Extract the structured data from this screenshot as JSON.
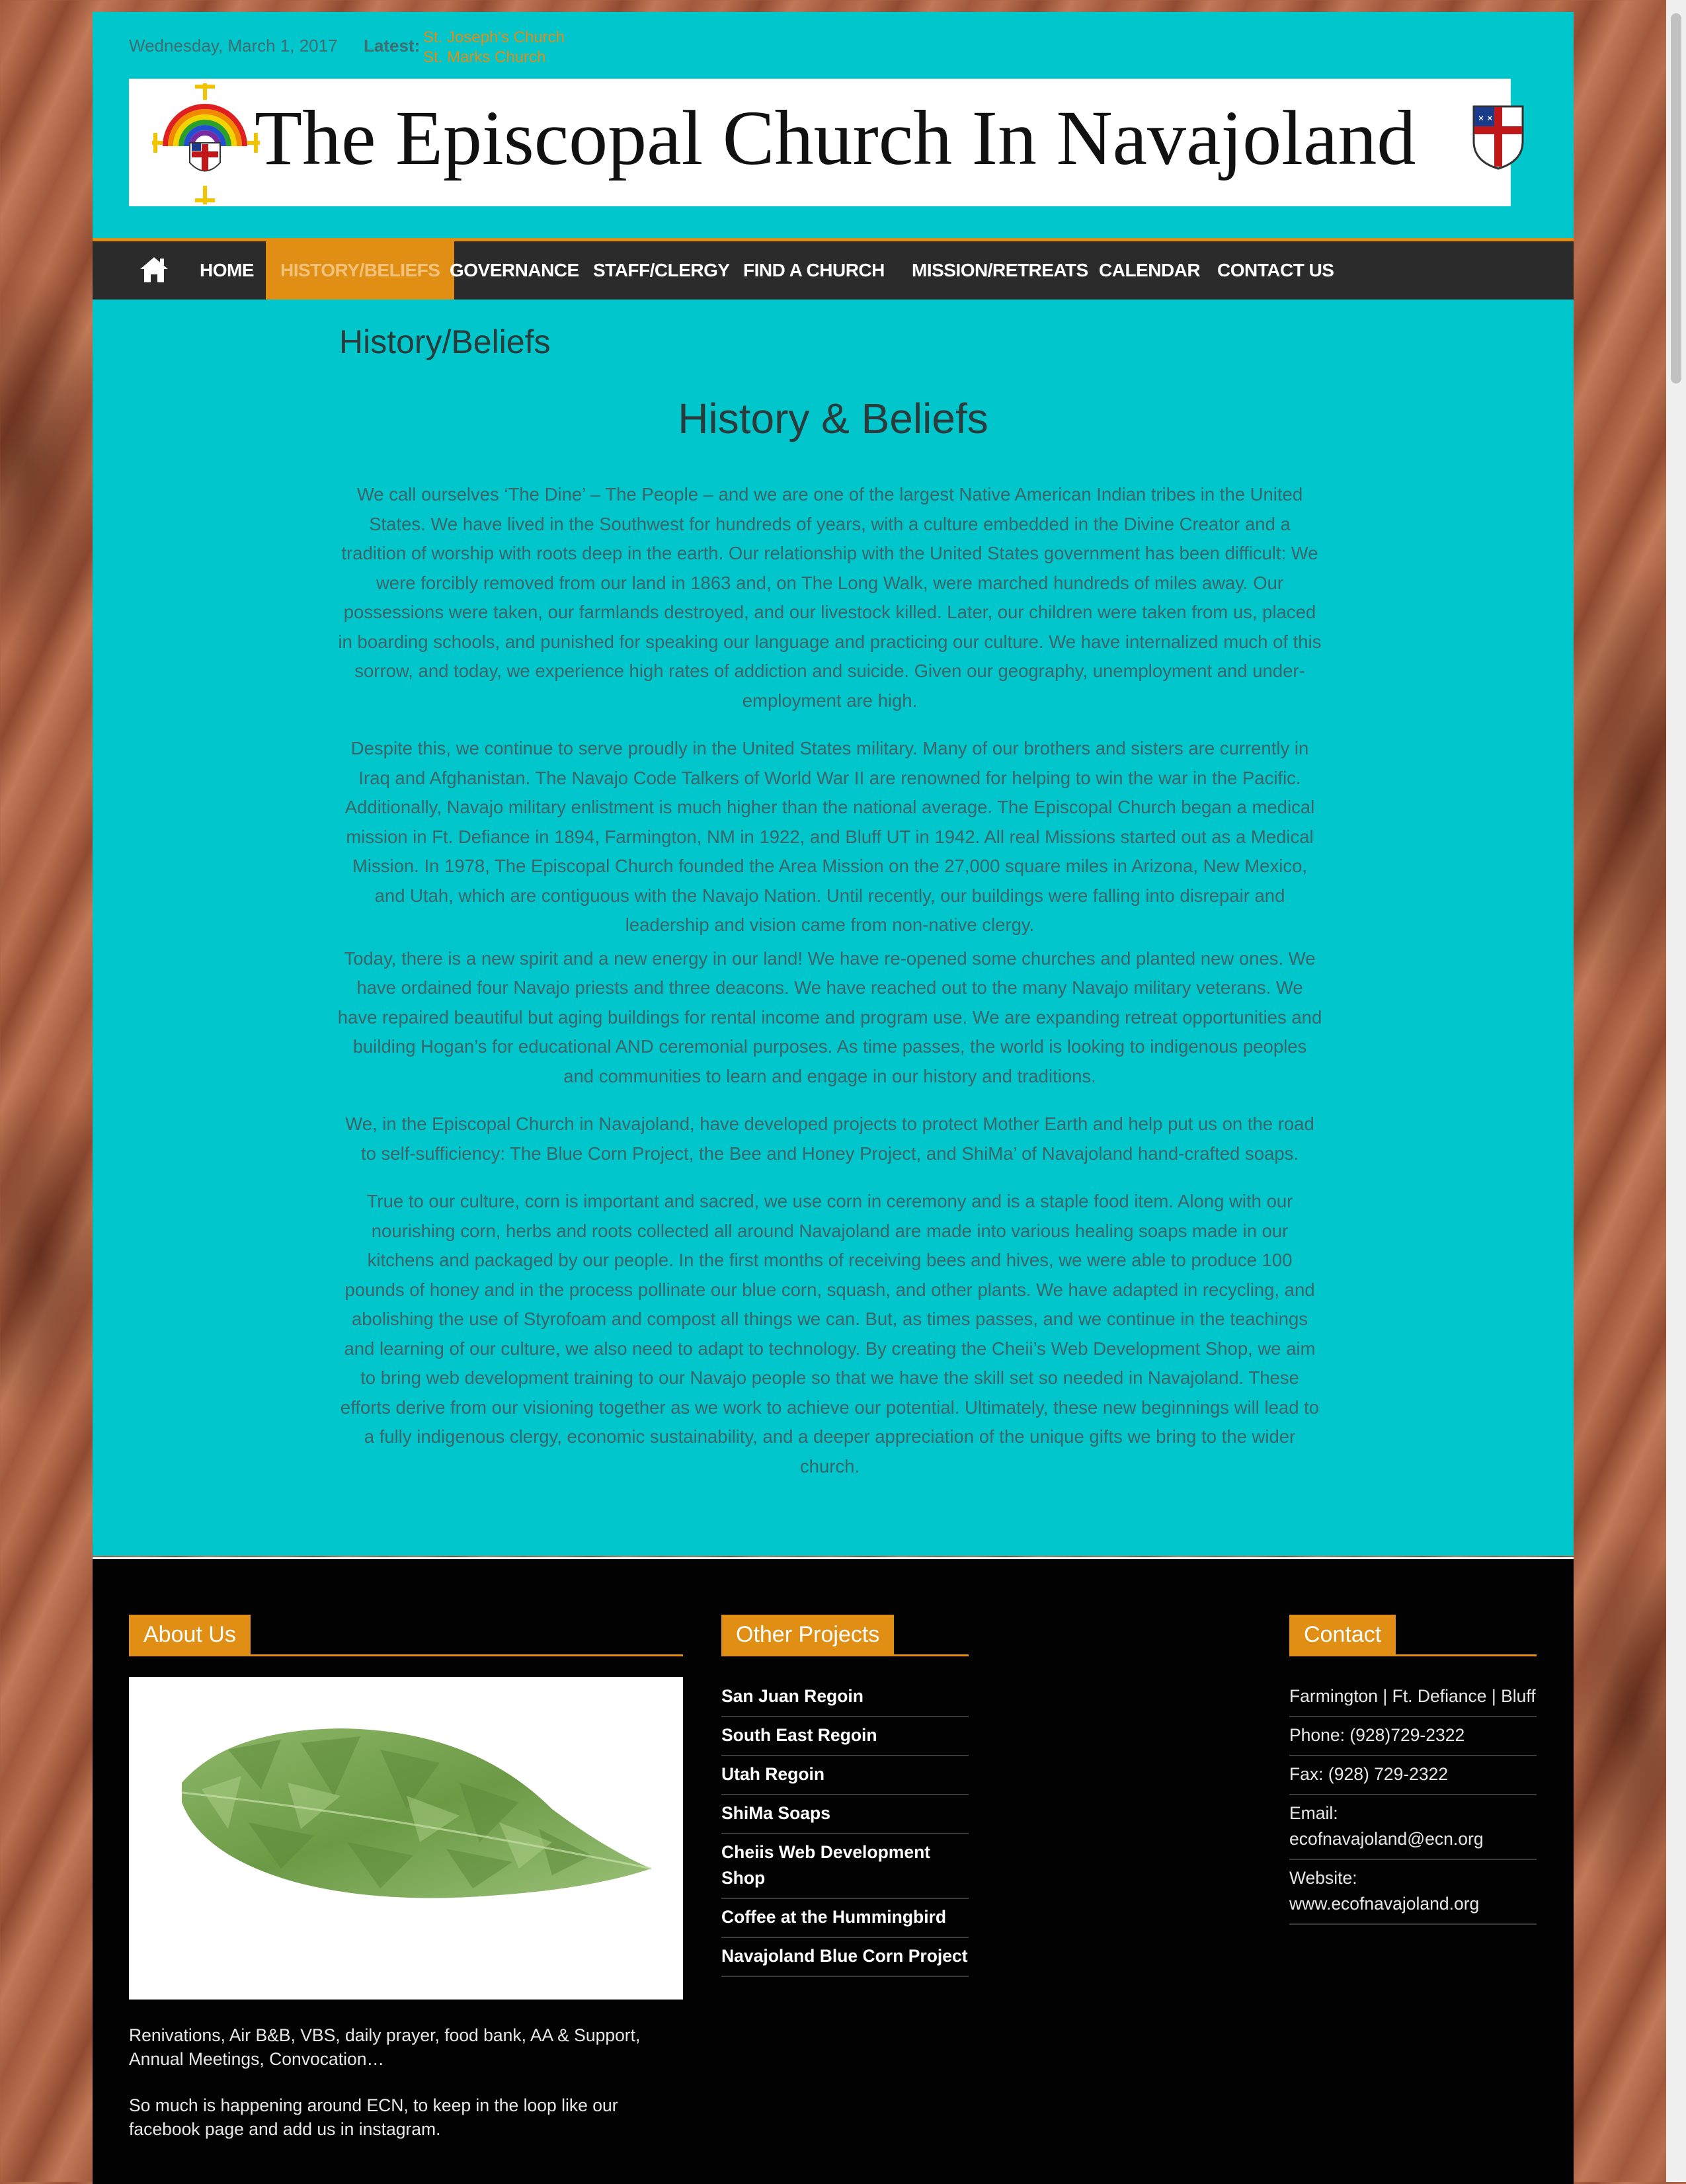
{
  "topbar": {
    "date": "Wednesday, March 1, 2017",
    "latest_label": "Latest:",
    "ticker": [
      "St. Joseph's Church",
      "St. Marks Church"
    ]
  },
  "logo": {
    "text": "The Episcopal Church In Navajoland",
    "emblem_icon": "rainbow-cross-emblem-icon",
    "shield_icon": "episcopal-shield-icon"
  },
  "nav": {
    "home_icon": "home-icon",
    "items": [
      "HOME",
      "HISTORY/BELIEFS",
      "GOVERNANCE",
      "STAFF/CLERGY",
      "FIND A CHURCH",
      "MISSION/RETREATS",
      "CALENDAR",
      "CONTACT US"
    ],
    "active": "HISTORY/BELIEFS"
  },
  "page": {
    "heading": "History/Beliefs",
    "title": "History & Beliefs",
    "paragraphs": [
      "We call ourselves ‘The Dine’ – The People – and we are one of the largest Native American Indian tribes in the United States. We have lived in the Southwest for hundreds of years, with a culture embedded in the Divine Creator and a tradition of worship with roots deep in the earth. Our relationship with the United States government has been difficult: We were forcibly removed from our land in 1863 and, on The Long Walk, were marched hundreds of miles away. Our possessions were taken, our farmlands destroyed, and our livestock killed. Later, our children were taken from us, placed in boarding schools, and punished for speaking our language and practicing our culture. We have internalized much of this sorrow, and today, we experience high rates of addiction and suicide. Given our geography, unemployment and under-employment are high.",
      "Despite this, we continue to serve proudly in the United States military. Many of our brothers and sisters are currently in Iraq and Afghanistan. The Navajo Code Talkers of World War II are renowned for helping to win the war in the Pacific. Additionally, Navajo military enlistment is much higher than the national average. The Episcopal Church began a medical mission in Ft. Defiance in 1894, Farmington, NM in 1922, and Bluff UT in 1942. All real Missions started out as a Medical Mission. In 1978, The Episcopal Church founded the Area Mission on the 27,000 square miles in Arizona, New Mexico, and Utah, which are contiguous with the Navajo Nation. Until recently, our buildings were falling into disrepair and leadership and vision came from non-native clergy.",
      "Today, there is a new spirit and a new energy in our land! We have re-opened some churches and planted new ones. We have ordained four Navajo priests and three deacons. We have reached out to the many Navajo military veterans. We have repaired beautiful but aging buildings for rental income and program use. We are expanding retreat opportunities and building Hogan’s for educational AND ceremonial purposes. As time passes, the world is looking to indigenous peoples and communities to learn and engage in our history and traditions.",
      "We, in the Episcopal Church in Navajoland, have developed projects to protect Mother Earth and help put us on the road to self-sufficiency: The Blue Corn Project, the Bee and Honey Project, and ShiMa’ of Navajoland hand-crafted soaps.",
      "True to our culture, corn is important and sacred, we use corn in ceremony and is a staple food item. Along with our nourishing corn, herbs and roots collected all around Navajoland are made into various healing soaps made in our kitchens and packaged by our people. In the first months of receiving bees and hives, we were able to produce 100 pounds of honey and in the process pollinate our blue corn, squash, and other plants. We have adapted in recycling, and abolishing the use of Styrofoam and compost all things we can. But, as times passes, and we continue in the teachings and learning of our culture, we also need to adapt to technology. By creating the Cheii’s Web Development Shop, we aim to bring web development training to our Navajo people so that we have the skill set so needed in Navajoland. These efforts derive from our visioning together as we work to achieve our potential. Ultimately, these new beginnings will lead to a fully indigenous clergy, economic sustainability, and a deeper appreciation of the unique gifts we bring to the wider church."
    ]
  },
  "footer": {
    "about": {
      "title": "About Us",
      "image_icon": "green-leaf-image",
      "text1": "Renivations, Air B&B, VBS, daily prayer, food bank, AA & Support, Annual Meetings, Convocation…",
      "text2": "So much is happening around ECN, to keep in the loop like our facebook page and add us in instagram."
    },
    "projects": {
      "title": "Other Projects",
      "items": [
        "San Juan Regoin",
        "South East Regoin",
        "Utah Regoin",
        "ShiMa Soaps",
        "Cheiis Web Development Shop",
        "Coffee at the Hummingbird",
        "Navajoland Blue Corn Project"
      ]
    },
    "contact": {
      "title": "Contact",
      "items": [
        "Farmington | Ft. Defiance | Bluff",
        "Phone: (928)729-2322",
        "Fax: (928) 729-2322",
        "Email: ecofnavajoland@ecn.org",
        "Website: www.ecofnavajoland.org"
      ]
    }
  },
  "colors": {
    "content_bg": "#01c6cc",
    "accent": "#e08f14",
    "nav_bg": "#2b2b2b",
    "footer_bg": "#020202"
  }
}
